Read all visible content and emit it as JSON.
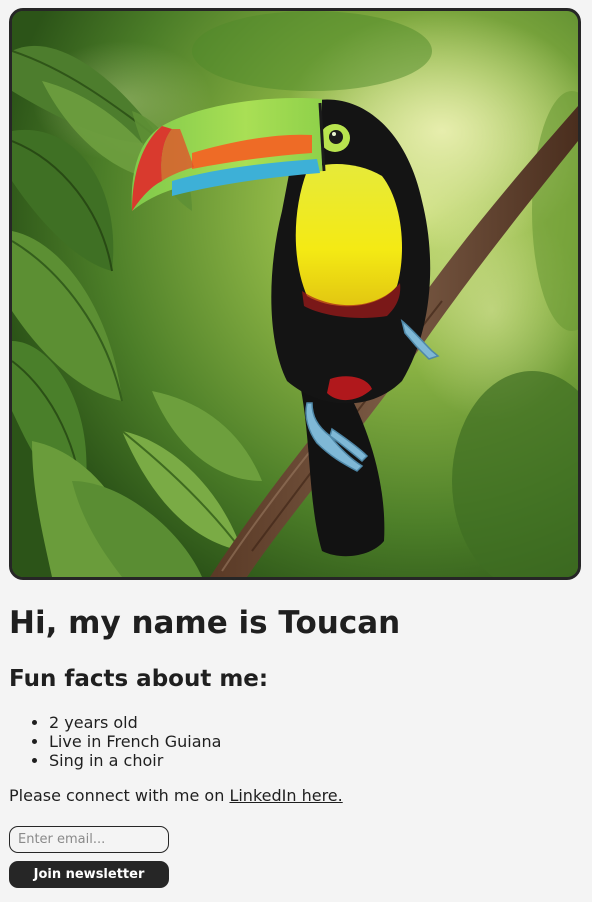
{
  "photo": {
    "subject": "keel-billed toucan perched on a branch in a rainforest"
  },
  "heading": {
    "title": "Hi, my name is Toucan",
    "facts_title": "Fun facts about me:"
  },
  "facts": [
    "2 years old",
    "Live in French Guiana",
    "Sing in a choir"
  ],
  "connect": {
    "prefix": "Please connect with me on ",
    "link_label": "LinkedIn here."
  },
  "newsletter": {
    "email_placeholder": "Enter email...",
    "email_value": "",
    "button_label": "Join newsletter"
  },
  "colors": {
    "background": "#f4f4f4",
    "frame_border": "#262626",
    "button_bg": "#262626",
    "button_text": "#ffffff",
    "text": "#1f1f1f"
  }
}
